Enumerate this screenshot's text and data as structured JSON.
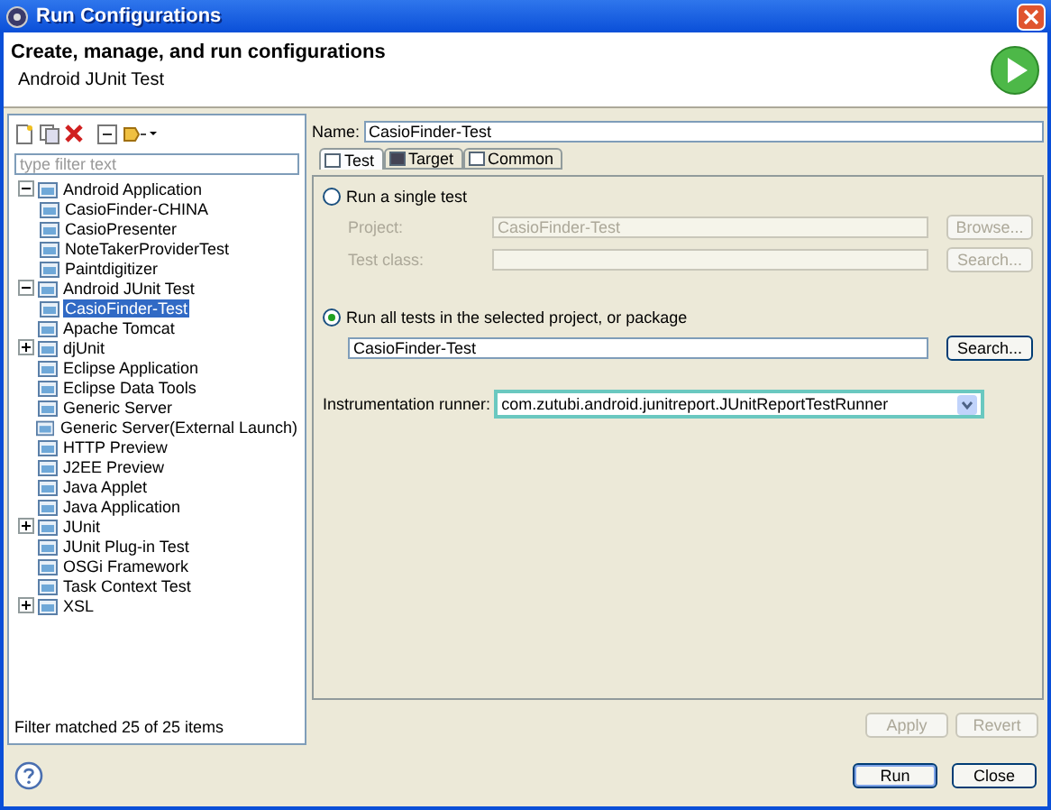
{
  "window": {
    "title": "Run Configurations"
  },
  "header": {
    "title": "Create, manage, and run configurations",
    "subtitle": "Android JUnit Test"
  },
  "filter": {
    "placeholder": "type filter text"
  },
  "tree": [
    {
      "label": "Android Application",
      "selected": false,
      "expanded": true,
      "children": [
        {
          "label": "CasioFinder-CHINA",
          "selected": false
        },
        {
          "label": "CasioPresenter",
          "selected": false
        },
        {
          "label": "NoteTakerProviderTest",
          "selected": false
        },
        {
          "label": "Paintdigitizer",
          "selected": false
        }
      ]
    },
    {
      "label": "Android JUnit Test",
      "selected": false,
      "expanded": true,
      "children": [
        {
          "label": "CasioFinder-Test",
          "selected": true
        }
      ]
    },
    {
      "label": "Apache Tomcat",
      "selected": false
    },
    {
      "label": "djUnit",
      "selected": false,
      "expanded": false
    },
    {
      "label": "Eclipse Application",
      "selected": false
    },
    {
      "label": "Eclipse Data Tools",
      "selected": false
    },
    {
      "label": "Generic Server",
      "selected": false
    },
    {
      "label": "Generic Server(External Launch)",
      "selected": false
    },
    {
      "label": "HTTP Preview",
      "selected": false
    },
    {
      "label": "J2EE Preview",
      "selected": false
    },
    {
      "label": "Java Applet",
      "selected": false
    },
    {
      "label": "Java Application",
      "selected": false
    },
    {
      "label": "JUnit",
      "selected": false,
      "expanded": false
    },
    {
      "label": "JUnit Plug-in Test",
      "selected": false
    },
    {
      "label": "OSGi Framework",
      "selected": false
    },
    {
      "label": "Task Context Test",
      "selected": false
    },
    {
      "label": "XSL",
      "selected": false,
      "expanded": false
    }
  ],
  "filter_status": "Filter matched 25 of 25 items",
  "name": {
    "label": "Name:",
    "value": "CasioFinder-Test"
  },
  "tabs": [
    {
      "label": "Test",
      "selected": true
    },
    {
      "label": "Target",
      "selected": false
    },
    {
      "label": "Common",
      "selected": false
    }
  ],
  "test_modes": [
    {
      "label": "Run a single test",
      "selected": false,
      "fields": [
        {
          "label": "Project:",
          "value": "CasioFinder-Test",
          "button": "Browse...",
          "disabled": true
        },
        {
          "label": "Test class:",
          "button": "Search...",
          "disabled": true
        }
      ]
    },
    {
      "label": "Run all tests in the selected project, or package",
      "selected": true,
      "fields": [
        {
          "value": "CasioFinder-Test",
          "button": "Search...",
          "disabled": false
        }
      ]
    }
  ],
  "runner": {
    "label": "Instrumentation runner:",
    "value": "com.zutubi.android.junitreport.JUnitReportTestRunner",
    "focused": true
  },
  "actions": [
    {
      "label": "Apply",
      "disabled": true
    },
    {
      "label": "Revert",
      "disabled": true
    }
  ],
  "buttons": [
    {
      "label": "Run",
      "default": true
    },
    {
      "label": "Close",
      "default": false
    }
  ]
}
